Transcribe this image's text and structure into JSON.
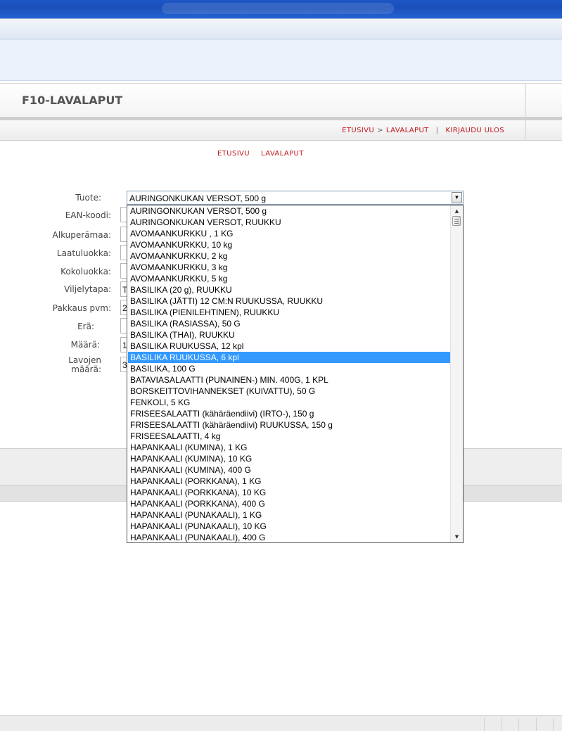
{
  "page": {
    "title": "F10-LAVALAPUT"
  },
  "topnav": {
    "home": "ETUSIVU",
    "separator": ">",
    "current": "LAVALAPUT",
    "divider": "|",
    "logout": "KIRJAUDU ULOS"
  },
  "subnav": {
    "home": "ETUSIVU",
    "current": "LAVALAPUT"
  },
  "form": {
    "labels": {
      "product": "Tuote:",
      "ean": "EAN-koodi:",
      "origin": "Alkuperämaa:",
      "quality": "Laatuluokka:",
      "size": "Kokoluokka:",
      "method": "Viljelytapa:",
      "pack_date": "Pakkaus pvm:",
      "batch": "Erä:",
      "amount": "Määrä:",
      "pallet_line1": "Lavojen",
      "pallet_line2": "määrä:"
    },
    "values": {
      "origin": "",
      "quality": "",
      "size": "",
      "method": "T",
      "pack_date": "2",
      "batch": "",
      "amount": "1",
      "pallets": "3"
    }
  },
  "product_select": {
    "selected_value": "AURINGONKUKAN VERSOT, 500 g",
    "highlighted_index": 13,
    "options": [
      "AURINGONKUKAN VERSOT, 500 g",
      "AURINGONKUKAN VERSOT, RUUKKU",
      "AVOMAANKURKKU , 1 KG",
      "AVOMAANKURKKU, 10 kg",
      "AVOMAANKURKKU, 2 kg",
      "AVOMAANKURKKU, 3 kg",
      "AVOMAANKURKKU, 5 kg",
      "BASILIKA (20 g), RUUKKU",
      "BASILIKA (JÄTTI) 12 CM:N RUUKUSSA, RUUKKU",
      "BASILIKA (PIENILEHTINEN), RUUKKU",
      "BASILIKA (RASIASSA), 50 G",
      "BASILIKA (THAI), RUUKKU",
      "BASILIKA RUUKUSSA, 12 kpl",
      "BASILIKA RUUKUSSA, 6 kpl",
      "BASILIKA, 100 G",
      "BATAVIASALAATTI (PUNAINEN-) MIN. 400G, 1 KPL",
      "BORSKEITTOVIHANNEKSET (KUIVATTU), 50 G",
      "FENKOLI, 5 KG",
      "FRISEESALAATTI (kähäräendiivi) (IRTO-), 150 g",
      "FRISEESALAATTI (kähäräendiivi) RUUKUSSA, 150 g",
      "FRISEESALAATTI, 4 kg",
      "HAPANKAALI (KUMINA), 1 KG",
      "HAPANKAALI (KUMINA), 10 KG",
      "HAPANKAALI (KUMINA), 400 G",
      "HAPANKAALI (PORKKANA), 1 KG",
      "HAPANKAALI (PORKKANA), 10 KG",
      "HAPANKAALI (PORKKANA), 400 G",
      "HAPANKAALI (PUNAKAALI), 1 KG",
      "HAPANKAALI (PUNAKAALI), 10 KG",
      "HAPANKAALI (PUNAKAALI), 400 G"
    ]
  },
  "colors": {
    "accent_red": "#c0161e",
    "selection_blue": "#3399ff",
    "title_gray": "#555555"
  },
  "icons": {
    "select_arrow": "chevron-down-icon",
    "scroll_up": "scroll-up-icon",
    "scroll_down": "scroll-down-icon"
  }
}
